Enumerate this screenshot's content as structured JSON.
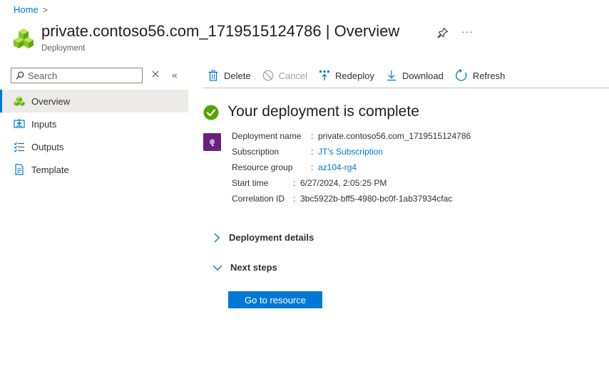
{
  "breadcrumb": {
    "home": "Home",
    "separator": ">"
  },
  "header": {
    "title": "private.contoso56.com_1719515124786 | Overview",
    "subtitle": "Deployment",
    "more": "···"
  },
  "sidebar": {
    "search_placeholder": "Search",
    "items": [
      {
        "label": "Overview",
        "icon": "overview-icon",
        "selected": true
      },
      {
        "label": "Inputs",
        "icon": "inputs-icon"
      },
      {
        "label": "Outputs",
        "icon": "outputs-icon"
      },
      {
        "label": "Template",
        "icon": "template-icon"
      }
    ]
  },
  "toolbar": {
    "delete": "Delete",
    "cancel": "Cancel",
    "redeploy": "Redeploy",
    "download": "Download",
    "refresh": "Refresh"
  },
  "status": {
    "title": "Your deployment is complete"
  },
  "details": {
    "deployment_name_label": "Deployment name",
    "deployment_name": "private.contoso56.com_1719515124786",
    "subscription_label": "Subscription",
    "subscription": "JT's Subscription",
    "resource_group_label": "Resource group",
    "resource_group": "az104-rg4",
    "start_time_label": "Start time",
    "start_time": "6/27/2024, 2:05:25 PM",
    "correlation_id_label": "Correlation ID",
    "correlation_id": "3bc5922b-bff5-4980-bc0f-1ab37934cfac",
    "colon": ":"
  },
  "sections": {
    "deployment_details": "Deployment details",
    "next_steps": "Next steps"
  },
  "actions": {
    "go_to_resource": "Go to resource"
  },
  "colors": {
    "accent": "#0078d4",
    "success": "#57a300",
    "deploy_icon": "#68217a"
  }
}
